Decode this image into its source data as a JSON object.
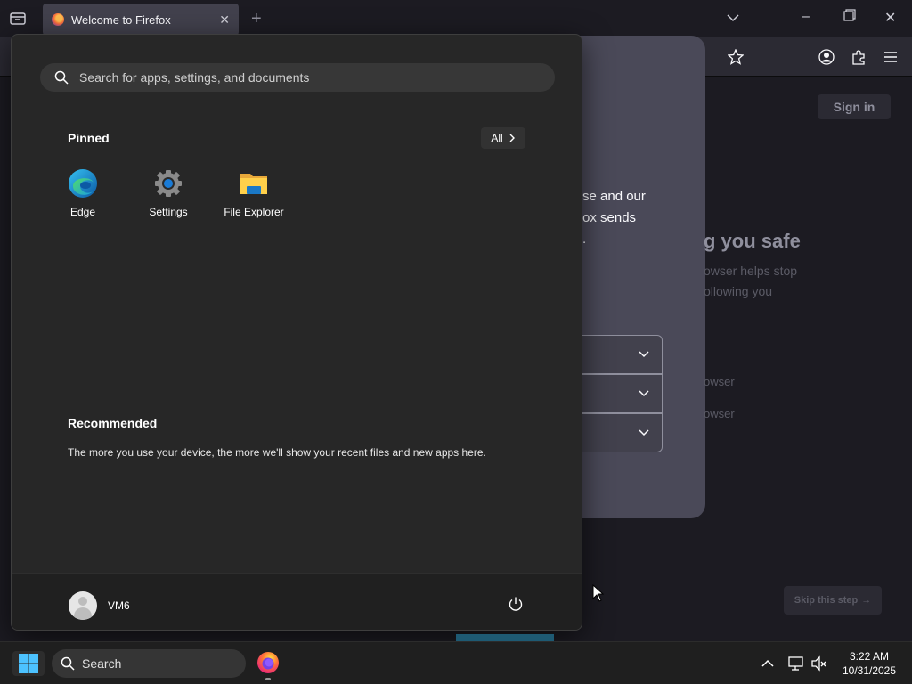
{
  "firefox": {
    "tab_title": "Welcome to Firefox",
    "sign_in_label": "Sign in",
    "partial_text_lines": [
      "se and our",
      "ox sends",
      "."
    ],
    "heading_partial": "g you safe",
    "sub_lines": [
      "owser helps stop",
      "ollowing you"
    ],
    "option_lines": [
      "owser",
      "owser"
    ],
    "skip_label": "Skip this step"
  },
  "start_menu": {
    "search_placeholder": "Search for apps, settings, and documents",
    "pinned_title": "Pinned",
    "all_label": "All",
    "pinned_apps": [
      {
        "label": "Edge",
        "icon": "edge-icon"
      },
      {
        "label": "Settings",
        "icon": "settings-gear-icon"
      },
      {
        "label": "File Explorer",
        "icon": "folder-icon"
      }
    ],
    "recommended_title": "Recommended",
    "recommended_text": "The more you use your device, the more we'll show your recent files and new apps here.",
    "user_name": "VM6"
  },
  "taskbar": {
    "search_label": "Search",
    "time": "3:22 AM",
    "date": "10/31/2025"
  }
}
